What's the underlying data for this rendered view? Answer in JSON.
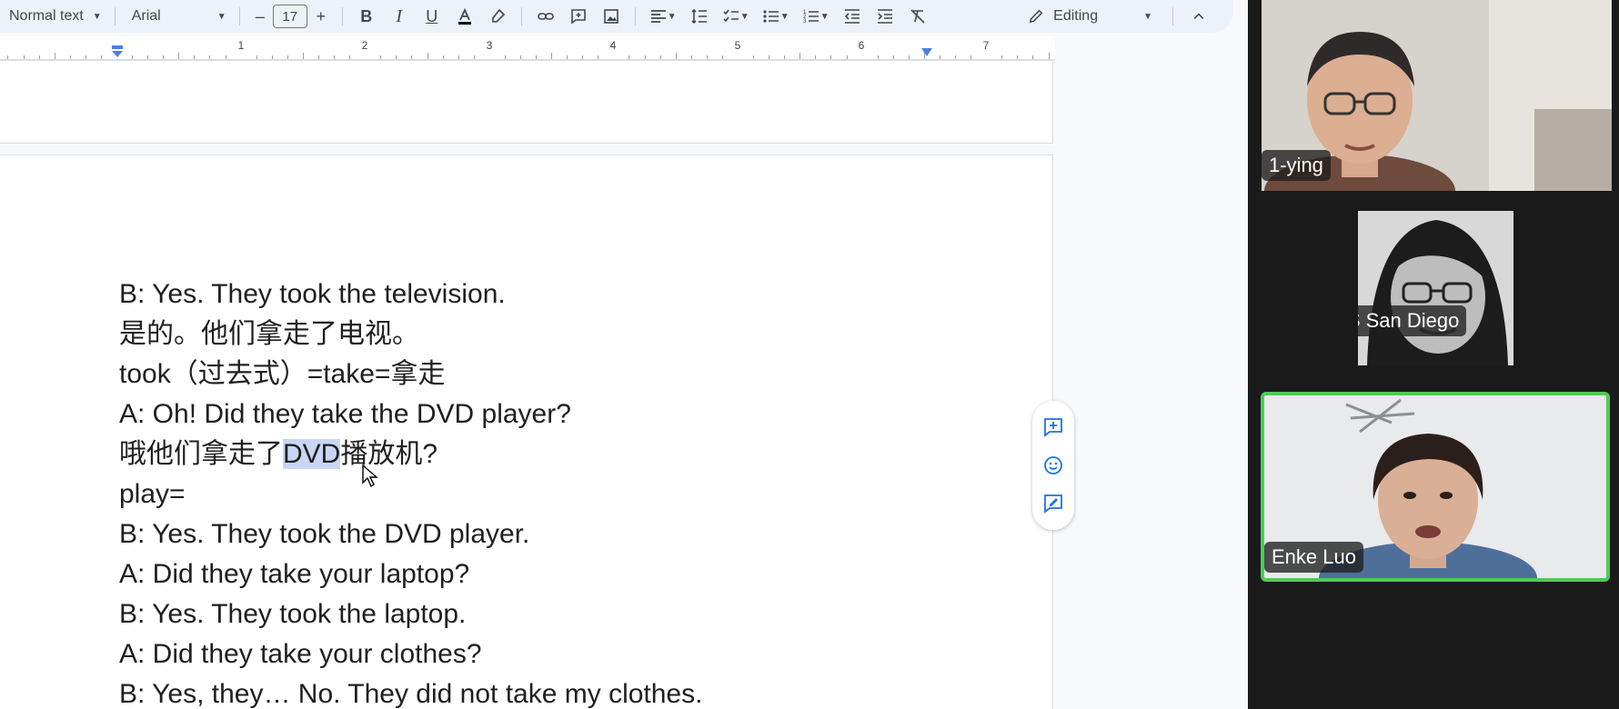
{
  "toolbar": {
    "style_select": "Normal text",
    "font_select": "Arial",
    "font_size": "17",
    "minus": "–",
    "plus": "+",
    "bold": "B",
    "italic": "I",
    "underline": "U",
    "mode": "Editing"
  },
  "ruler": {
    "numbers": [
      "1",
      "2",
      "3",
      "4",
      "5",
      "6",
      "7"
    ]
  },
  "document": {
    "lines": [
      "B: Yes. They took the television.",
      "是的。他们拿走了电视。",
      "took（过去式）=take=拿走",
      "A: Oh! Did they take the DVD player?",
      {
        "before": "哦他们拿走了",
        "selected": "DVD",
        "after": "播放机?"
      },
      "play=",
      "B: Yes. They took the DVD player.",
      "A: Did they take your laptop?",
      "B: Yes. They took the laptop.",
      "A: Did they take your clothes?",
      "B: Yes, they… No. They did not take my clothes."
    ]
  },
  "participants": [
    {
      "name": "1-ying",
      "muted": false,
      "active": false
    },
    {
      "name": "AYLUS San Diego",
      "muted": true,
      "active": false
    },
    {
      "name": "Enke Luo",
      "muted": false,
      "active": true
    }
  ],
  "colors": {
    "active_speaker": "#4fca55",
    "muted_icon": "#e53935",
    "selection": "#c9d7f5",
    "toolbar_bg": "#edf2fa"
  }
}
